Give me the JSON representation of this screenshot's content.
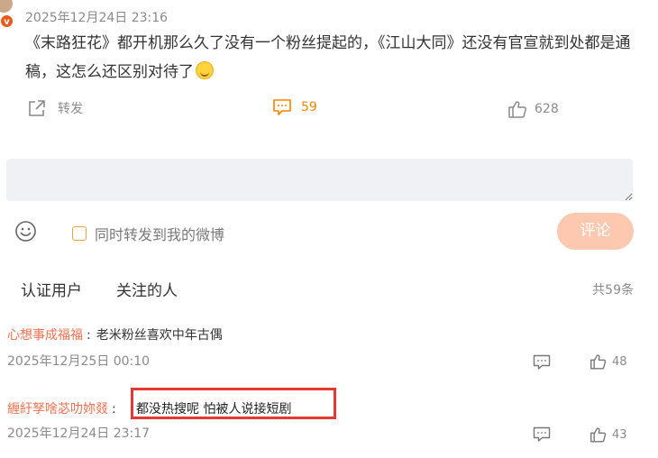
{
  "post": {
    "timestamp": "2025年12月24日 23:16",
    "badge": "v",
    "text": "《末路狂花》都开机那么久了没有一个粉丝提起的，《江山大同》还没有官宣就到处都是通稿，这怎么还区别对待了",
    "emoji": "laugh-cry-emoji"
  },
  "actions": {
    "share_label": "转发",
    "comment_count": "59",
    "like_count": "628"
  },
  "composer": {
    "input_value": "",
    "repost_label": "同时转发到我的微博",
    "submit_label": "评论"
  },
  "filters": {
    "tabs": [
      "认证用户",
      "关注的人"
    ],
    "total": "共59条"
  },
  "replies": [
    {
      "user": "心想事成福福",
      "text": "老米粉丝喜欢中年古偶",
      "time": "2025年12月25日 00:10",
      "likes": "48"
    },
    {
      "user": "緾紆孥啥苾叻妳叕",
      "text": "都没热搜呢 怕被人说接短剧",
      "time": "2025年12月24日 23:17",
      "likes": "43"
    }
  ],
  "colors": {
    "accent_orange": "#ff8200",
    "username": "#eb7350",
    "submit_bg": "#fcc8b0",
    "highlight_border": "#e53935"
  }
}
